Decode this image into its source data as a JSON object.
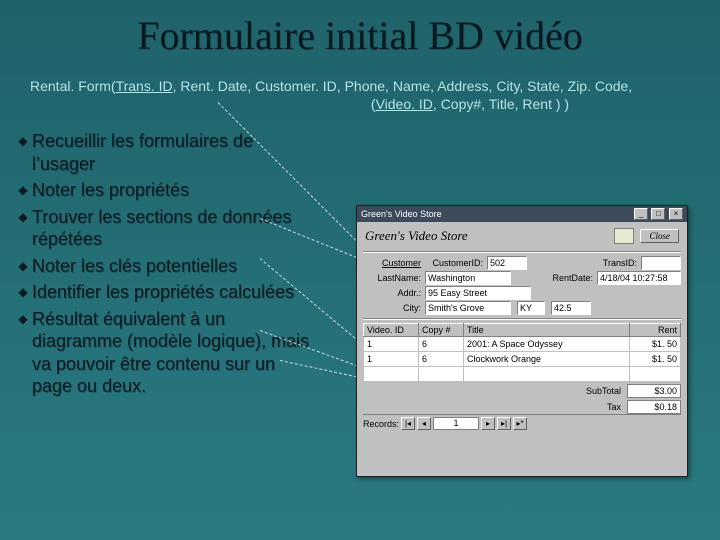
{
  "title": "Formulaire initial BD vidéo",
  "schema": {
    "line1_pre": "Rental. Form(",
    "line1_key": "Trans. ID",
    "line1_rest": ", Rent. Date, Customer. ID, Phone, Name, Address, City, State, Zip. Code,",
    "line2_pre": "(",
    "line2_key": "Video. ID",
    "line2_rest": ", Copy#, Title, Rent ) )"
  },
  "bullets": [
    "Recueillir les formulaires de l’usager",
    "Noter les propriétés",
    "Trouver les sections de données répétées",
    "Noter les clés potentielles",
    "Identifier les propriétés calculées",
    "Résultat équivalent à un diagramme (modèle logique), mais va pouvoir être contenu sur un page ou deux."
  ],
  "app": {
    "windowTitle": "Green's Video Store",
    "headerTitle": "Green's Video Store",
    "closeLabel": "Close",
    "fields": {
      "customerLabel": "Customer",
      "customerIdLabel": "CustomerID:",
      "customerId": "502",
      "transIdLabel": "TransID:",
      "transId": "",
      "lastNameLabel": "LastName:",
      "lastName": "Washington",
      "rentDateLabel": "RentDate:",
      "rentDate": "4/18/04 10:27:58",
      "addressLabel": "Addr.:",
      "address": "95 Easy Street",
      "cityLabel": "City:",
      "city": "Smith's Grove",
      "stateLabel": "",
      "state": "KY",
      "zip": "42.5"
    },
    "table": {
      "headers": [
        "Video. ID",
        "Copy #",
        "Title",
        "Rent"
      ],
      "rows": [
        [
          "1",
          "6",
          "2001: A Space Odyssey",
          "$1. 50"
        ],
        [
          "1",
          "6",
          "Clockwork Orange",
          "$1. 50"
        ],
        [
          "",
          "",
          "",
          ""
        ]
      ]
    },
    "subTotalLabel": "SubTotal",
    "subTotal": "$3.00",
    "taxLabel": "Tax",
    "tax": "$0.18",
    "recordsLabel": "Records:",
    "recordPos": "1"
  }
}
